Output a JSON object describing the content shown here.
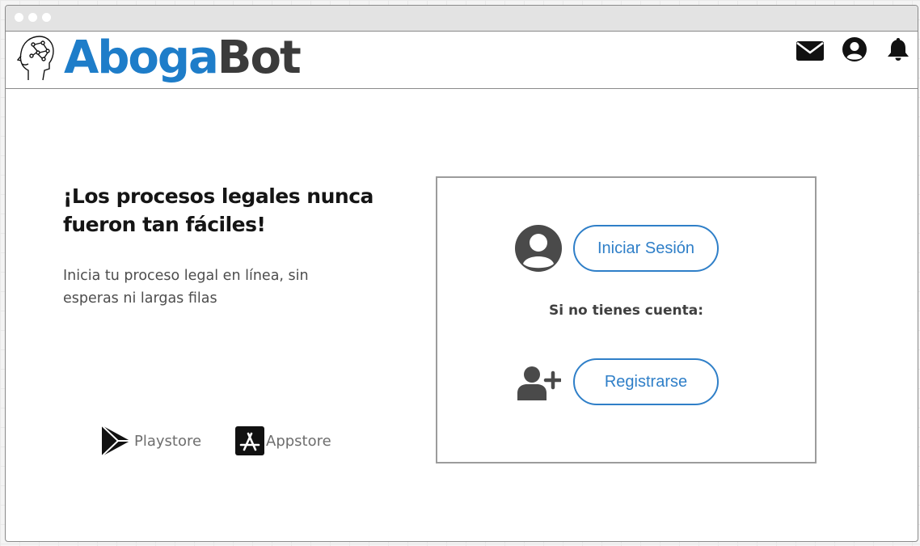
{
  "header": {
    "logo_part1": "Aboga",
    "logo_part2": "Bot",
    "icons": [
      "brain-circuit-icon",
      "mail-icon",
      "user-circle-icon",
      "bell-icon"
    ]
  },
  "hero": {
    "title": "¡Los procesos legales nunca fueron tan fáciles!",
    "subtitle": "Inicia tu proceso legal en línea, sin esperas ni largas filas"
  },
  "stores": [
    {
      "label": "Playstore",
      "icon": "play-store-icon"
    },
    {
      "label": "Appstore",
      "icon": "app-store-icon"
    }
  ],
  "login_panel": {
    "login_label": "Iniciar Sesión",
    "no_account_text": "Si no tienes cuenta:",
    "register_label": "Registrarse"
  },
  "colors": {
    "brand_blue": "#1e7dc9",
    "brand_dark": "#3b3b3b",
    "button_blue": "#2f7fc8"
  }
}
